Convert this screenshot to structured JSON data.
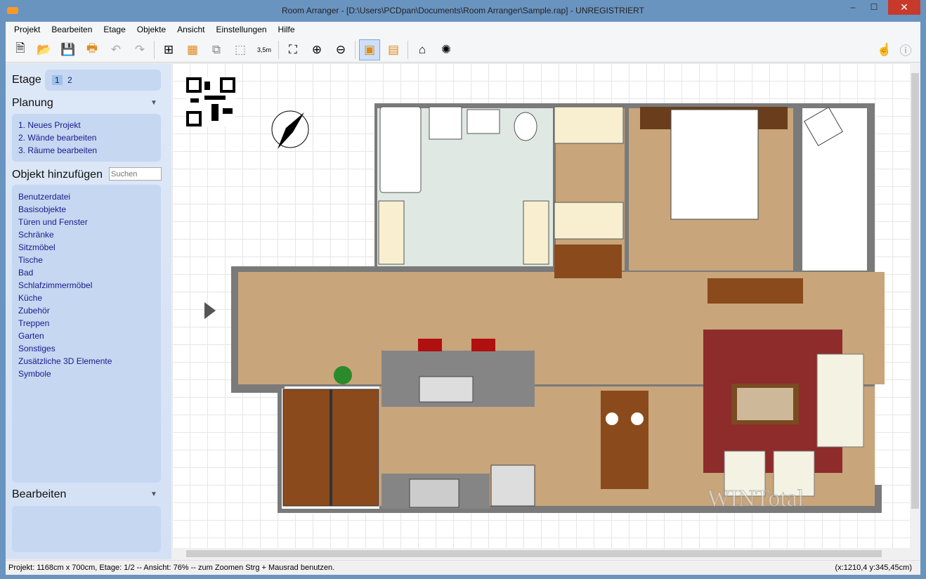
{
  "window": {
    "title": "Room Arranger - [D:\\Users\\PCDpan\\Documents\\Room Arranger\\Sample.rap] - UNREGISTRIERT",
    "minimize": "–",
    "maximize": "☐",
    "close": "✕"
  },
  "menu": [
    "Projekt",
    "Bearbeiten",
    "Etage",
    "Objekte",
    "Ansicht",
    "Einstellungen",
    "Hilfe"
  ],
  "toolbar": {
    "new": "🗎",
    "open": "📂",
    "save": "💾",
    "print": "🖶",
    "undo": "↶",
    "redo": "↷",
    "room": "⊞",
    "wall": "▦",
    "select": "⧉",
    "object": "⬚",
    "measure": "3,5m",
    "zoom_fit": "⛶",
    "zoom_in": "⊕",
    "zoom_out": "⊖",
    "view2d": "▣",
    "objlist": "▤",
    "view3d": "⌂",
    "render": "✺",
    "hand": "☝",
    "info": "ⓘ"
  },
  "sidebar": {
    "etage_label": "Etage",
    "floors": [
      "1",
      "2"
    ],
    "active_floor": "1",
    "planung_label": "Planung",
    "planung_items": [
      "1. Neues Projekt",
      "2. Wände bearbeiten",
      "3. Räume bearbeiten"
    ],
    "objekt_label": "Objekt hinzufügen",
    "search_placeholder": "Suchen",
    "categories": [
      "Benutzerdatei",
      "Basisobjekte",
      "Türen und Fenster",
      "Schränke",
      "Sitzmöbel",
      "Tische",
      "Bad",
      "Schlafzimmermöbel",
      "Küche",
      "Zubehör",
      "Treppen",
      "Garten",
      "Sonstiges",
      "Zusätzliche 3D Elemente",
      "Symbole"
    ],
    "bearbeiten_label": "Bearbeiten",
    "collapse": "▼"
  },
  "canvas": {
    "watermark": "WINTotal",
    "colors": {
      "floor": "#c8a57a",
      "wall": "#6e6e6e",
      "tile": "#dfe8e2",
      "carpet": "#8e2b2b",
      "stairs": "#8a4a1c",
      "counter": "#777777"
    }
  },
  "status": {
    "text": "Projekt: 1168cm x 700cm, Etage: 1/2 -- Ansicht: 76% -- zum Zoomen Strg + Mausrad benutzen.",
    "coords": "(x:1210,4 y:345,45cm)"
  }
}
